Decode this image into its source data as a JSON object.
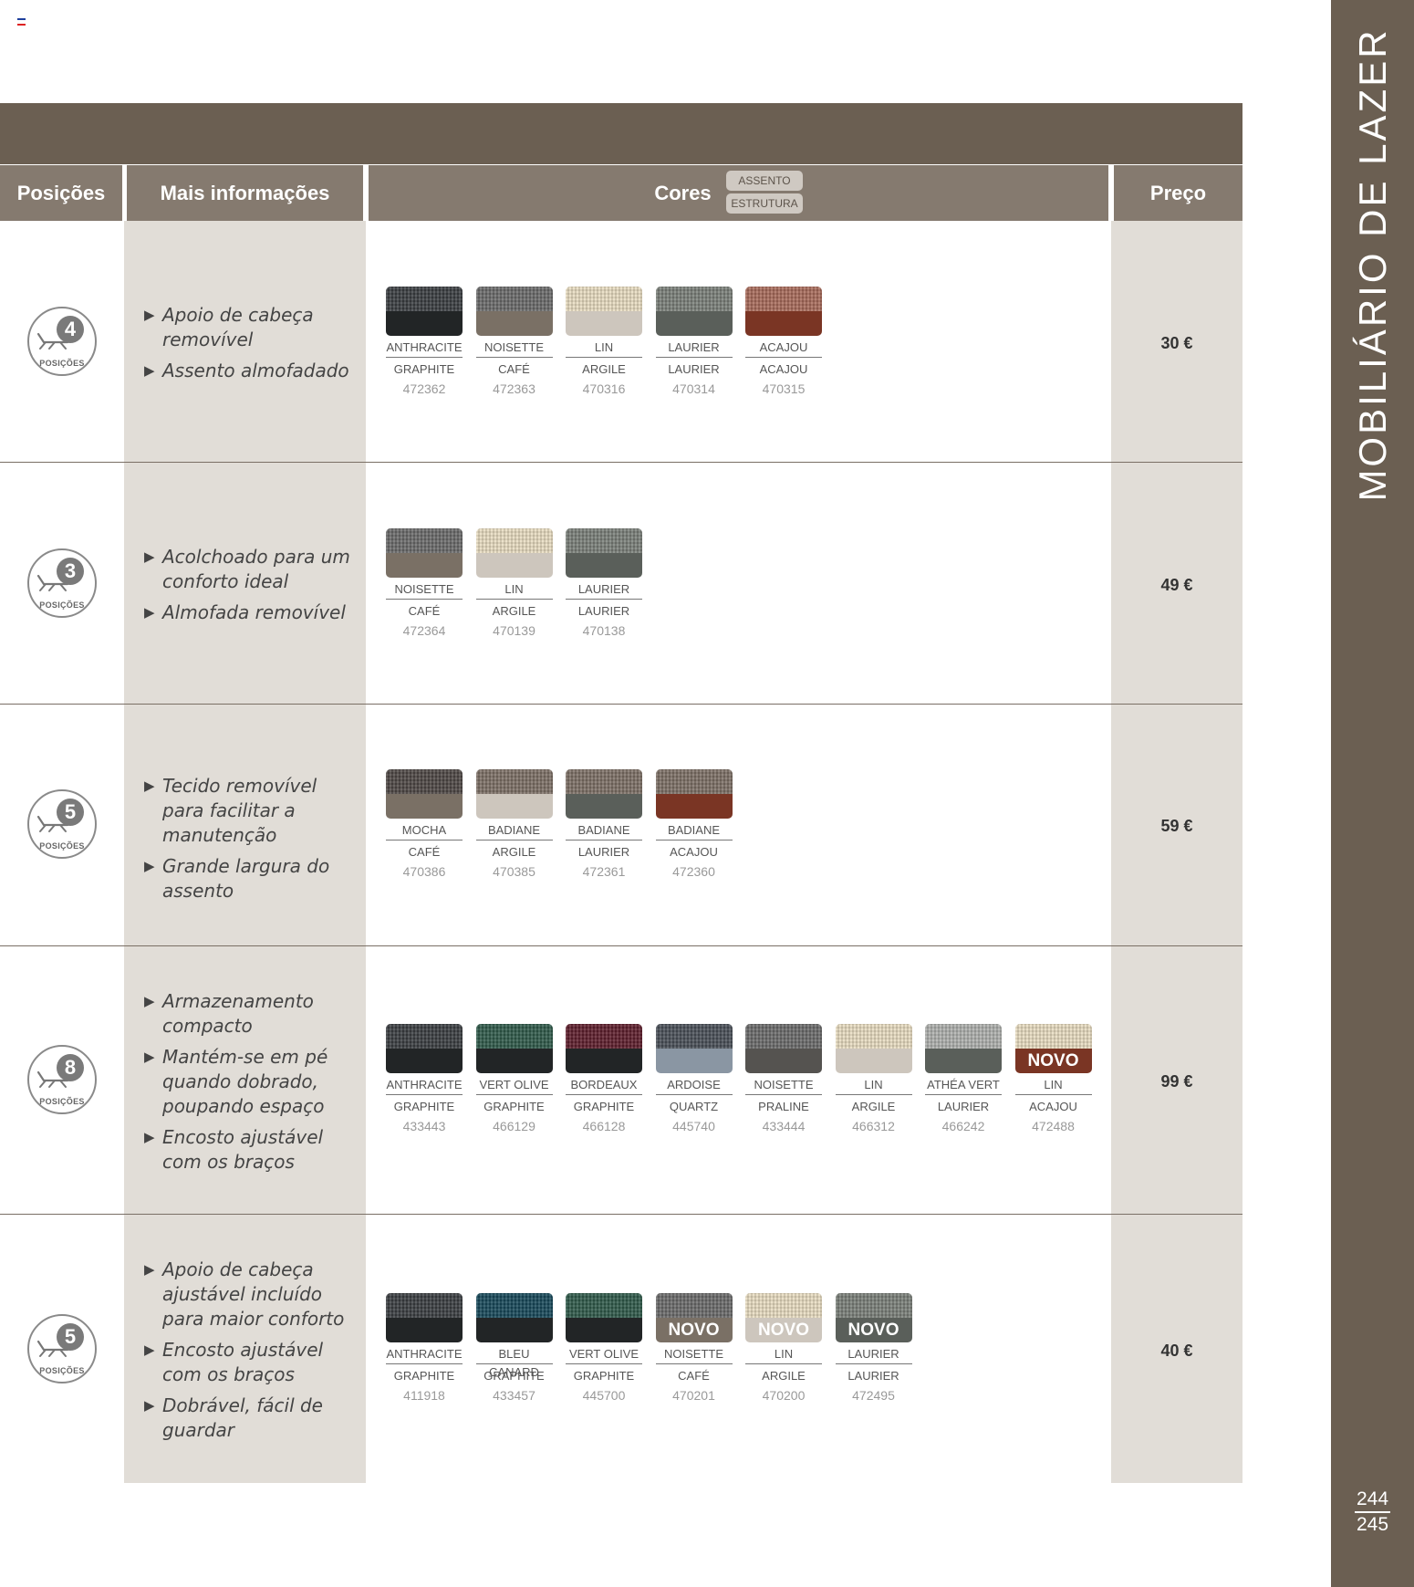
{
  "header": {
    "positions": "Posições",
    "more_info": "Mais informações",
    "colors": "Cores",
    "price": "Preço",
    "legend_seat": "ASSENTO",
    "legend_frame": "ESTRUTURA"
  },
  "sidebar": {
    "title": "MOBILIÁRIO DE LAZER",
    "page_left": "244",
    "page_right": "245"
  },
  "rows": [
    {
      "positions": "4",
      "positions_label": "POSIÇÕES",
      "info": [
        "Apoio de cabeça removível",
        "Assento almofadado"
      ],
      "price": "30 €",
      "swatches": [
        {
          "seat": "ANTHRACITE",
          "frame": "GRAPHITE",
          "ref": "472362",
          "top": "#3b3e41",
          "bottom": "#222526"
        },
        {
          "seat": "NOISETTE",
          "frame": "CAFÉ",
          "ref": "472363",
          "top": "#6a6a6a",
          "bottom": "#7a7065"
        },
        {
          "seat": "LIN",
          "frame": "ARGILE",
          "ref": "470316",
          "top": "#e8dcc0",
          "bottom": "#cdc6bd"
        },
        {
          "seat": "LAURIER",
          "frame": "LAURIER",
          "ref": "470314",
          "top": "#7a7f78",
          "bottom": "#5a5f5a"
        },
        {
          "seat": "ACAJOU",
          "frame": "ACAJOU",
          "ref": "470315",
          "top": "#a86a5a",
          "bottom": "#7a3524"
        }
      ]
    },
    {
      "positions": "3",
      "positions_label": "POSIÇÕES",
      "info": [
        "Acolchoado para um conforto ideal",
        "Almofada removível"
      ],
      "price": "49 €",
      "swatches": [
        {
          "seat": "NOISETTE",
          "frame": "CAFÉ",
          "ref": "472364",
          "top": "#6a6a6a",
          "bottom": "#7a7065"
        },
        {
          "seat": "LIN",
          "frame": "ARGILE",
          "ref": "470139",
          "top": "#e8dcc0",
          "bottom": "#cdc6bd"
        },
        {
          "seat": "LAURIER",
          "frame": "LAURIER",
          "ref": "470138",
          "top": "#7a7f78",
          "bottom": "#5a5f5a"
        }
      ]
    },
    {
      "positions": "5",
      "positions_label": "POSIÇÕES",
      "info": [
        "Tecido removível para facilitar a manutenção",
        "Grande largura do assento"
      ],
      "price": "59 €",
      "swatches": [
        {
          "seat": "MOCHA",
          "frame": "CAFÉ",
          "ref": "470386",
          "top": "#4e4845",
          "bottom": "#7a7065"
        },
        {
          "seat": "BADIANE",
          "frame": "ARGILE",
          "ref": "470385",
          "top": "#7d7066",
          "bottom": "#cdc6bd"
        },
        {
          "seat": "BADIANE",
          "frame": "LAURIER",
          "ref": "472361",
          "top": "#7d7066",
          "bottom": "#5a5f5a"
        },
        {
          "seat": "BADIANE",
          "frame": "ACAJOU",
          "ref": "472360",
          "top": "#7d7066",
          "bottom": "#7a3524"
        }
      ]
    },
    {
      "positions": "8",
      "positions_label": "POSIÇÕES",
      "info": [
        "Armazenamento compacto",
        "Mantém-se em pé quando dobrado, poupando espaço",
        "Encosto ajustável com os braços"
      ],
      "price": "99 €",
      "swatches": [
        {
          "seat": "ANTHRACITE",
          "frame": "GRAPHITE",
          "ref": "433443",
          "top": "#3b3e41",
          "bottom": "#222526"
        },
        {
          "seat": "VERT OLIVE",
          "frame": "GRAPHITE",
          "ref": "466129",
          "top": "#2f5a4a",
          "bottom": "#222526"
        },
        {
          "seat": "BORDEAUX",
          "frame": "GRAPHITE",
          "ref": "466128",
          "top": "#5e1e2c",
          "bottom": "#222526"
        },
        {
          "seat": "ARDOISE",
          "frame": "QUARTZ",
          "ref": "445740",
          "top": "#4a5058",
          "bottom": "#8a96a3"
        },
        {
          "seat": "NOISETTE",
          "frame": "PRALINE",
          "ref": "433444",
          "top": "#6a6a6a",
          "bottom": "#555350"
        },
        {
          "seat": "LIN",
          "frame": "ARGILE",
          "ref": "466312",
          "top": "#e8dcc0",
          "bottom": "#cdc6bd"
        },
        {
          "seat": "ATHÉA VERT",
          "frame": "LAURIER",
          "ref": "466242",
          "top": "#aeb0ad",
          "bottom": "#5a5f5a"
        },
        {
          "seat": "LIN",
          "frame": "ACAJOU",
          "ref": "472488",
          "top": "#e8dcc0",
          "bottom": "#7a3524",
          "badge": "NOVO"
        }
      ]
    },
    {
      "positions": "5",
      "positions_label": "POSIÇÕES",
      "info": [
        "Apoio de cabeça ajustável incluído para maior conforto",
        "Encosto ajustável com os braços",
        "Dobrável, fácil de guardar"
      ],
      "price": "40 €",
      "swatches": [
        {
          "seat": "ANTHRACITE",
          "frame": "GRAPHITE",
          "ref": "411918",
          "top": "#3b3e41",
          "bottom": "#222526"
        },
        {
          "seat": "BLEU CANARD",
          "frame": "GRAPHITE",
          "ref": "433457",
          "top": "#17495a",
          "bottom": "#222526"
        },
        {
          "seat": "VERT OLIVE",
          "frame": "GRAPHITE",
          "ref": "445700",
          "top": "#2f5a4a",
          "bottom": "#222526"
        },
        {
          "seat": "NOISETTE",
          "frame": "CAFÉ",
          "ref": "470201",
          "top": "#6a6a6a",
          "bottom": "#7a7065",
          "badge": "NOVO"
        },
        {
          "seat": "LIN",
          "frame": "ARGILE",
          "ref": "470200",
          "top": "#e8dcc0",
          "bottom": "#cdc6bd",
          "badge": "NOVO"
        },
        {
          "seat": "LAURIER",
          "frame": "LAURIER",
          "ref": "472495",
          "top": "#7a7f78",
          "bottom": "#5a5f5a",
          "badge": "NOVO"
        }
      ]
    }
  ]
}
